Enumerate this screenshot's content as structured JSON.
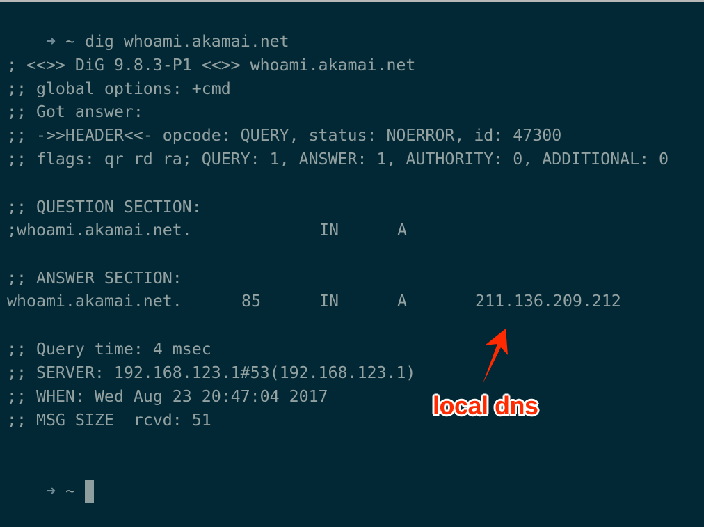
{
  "terminal": {
    "prompt": {
      "arrow_icon": "right-arrow",
      "cwd": "~"
    },
    "command": "dig whoami.akamai.net",
    "output": {
      "banner": "; <<>> DiG 9.8.3-P1 <<>> whoami.akamai.net",
      "global_options": ";; global options: +cmd",
      "got_answer": ";; Got answer:",
      "header": ";; ->>HEADER<<- opcode: QUERY, status: NOERROR, id: 47300",
      "flags": ";; flags: qr rd ra; QUERY: 1, ANSWER: 1, AUTHORITY: 0, ADDITIONAL: 0",
      "question_section_title": ";; QUESTION SECTION:",
      "question_record": {
        "name": ";whoami.akamai.net.",
        "class": "IN",
        "type": "A"
      },
      "answer_section_title": ";; ANSWER SECTION:",
      "answer_record": {
        "name": "whoami.akamai.net.",
        "ttl": "85",
        "class": "IN",
        "type": "A",
        "address": "211.136.209.212"
      },
      "query_time": ";; Query time: 4 msec",
      "server": ";; SERVER: 192.168.123.1#53(192.168.123.1)",
      "when": ";; WHEN: Wed Aug 23 20:47:04 2017",
      "msg_size": ";; MSG SIZE  rcvd: 51"
    },
    "final_prompt": {
      "arrow_icon": "right-arrow",
      "cwd": "~"
    }
  },
  "annotation": {
    "label": "local dns",
    "color": "#ff2a00",
    "points_to": "answer_record.address"
  },
  "colors": {
    "background": "#022835",
    "text": "#93a1a1",
    "prompt_arrow": "#6f8a94",
    "cursor": "#8e9e9f"
  }
}
